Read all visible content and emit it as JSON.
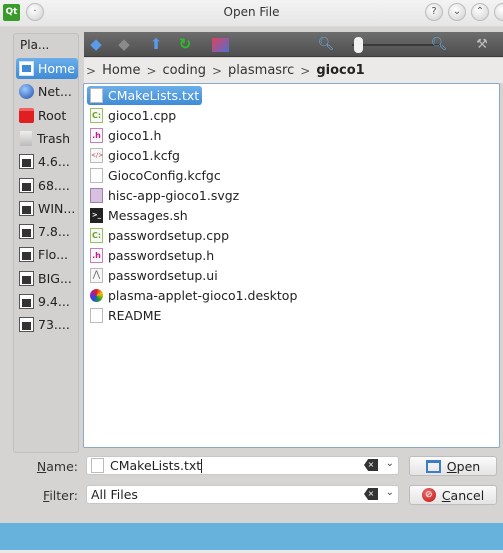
{
  "window": {
    "title": "Open File",
    "app_icon": "qt-icon",
    "controls": [
      "help-icon",
      "minimize-icon",
      "maximize-icon"
    ]
  },
  "places": {
    "header": "Pla...",
    "items": [
      {
        "label": "Home",
        "icon": "home-folder-icon",
        "active": true
      },
      {
        "label": "Net...",
        "icon": "network-globe-icon"
      },
      {
        "label": "Root",
        "icon": "root-folder-icon"
      },
      {
        "label": "Trash",
        "icon": "trash-icon"
      },
      {
        "label": "4.6...",
        "icon": "drive-icon"
      },
      {
        "label": "68....",
        "icon": "drive-icon"
      },
      {
        "label": "WIN...",
        "icon": "drive-icon"
      },
      {
        "label": "7.8...",
        "icon": "drive-icon"
      },
      {
        "label": "Flo...",
        "icon": "floppy-icon"
      },
      {
        "label": "BIG...",
        "icon": "drive-icon"
      },
      {
        "label": "9.4...",
        "icon": "drive-icon"
      },
      {
        "label": "73....",
        "icon": "drive-icon"
      }
    ]
  },
  "toolbar": {
    "buttons": [
      "back-arrow-icon",
      "forward-arrow-icon",
      "up-arrow-icon",
      "reload-icon",
      "new-folder-icon"
    ],
    "zoom_level": 0.1
  },
  "breadcrumb": {
    "items": [
      "Home",
      "coding",
      "plasmasrc",
      "gioco1"
    ]
  },
  "files": [
    {
      "name": "CMakeLists.txt",
      "type": "txt",
      "selected": true
    },
    {
      "name": "gioco1.cpp",
      "type": "cpp"
    },
    {
      "name": "gioco1.h",
      "type": "h"
    },
    {
      "name": "gioco1.kcfg",
      "type": "kcfg"
    },
    {
      "name": "GiocoConfig.kcfgc",
      "type": "txt"
    },
    {
      "name": "hisc-app-gioco1.svgz",
      "type": "svg"
    },
    {
      "name": "Messages.sh",
      "type": "sh"
    },
    {
      "name": "passwordsetup.cpp",
      "type": "cpp"
    },
    {
      "name": "passwordsetup.h",
      "type": "h"
    },
    {
      "name": "passwordsetup.ui",
      "type": "ui"
    },
    {
      "name": "plasma-applet-gioco1.desktop",
      "type": "desk"
    },
    {
      "name": "README",
      "type": "txt"
    }
  ],
  "form": {
    "name_label_pre": "",
    "name_label_u": "N",
    "name_label_post": "ame:",
    "name_value": "CMakeLists.txt",
    "filter_label_u": "F",
    "filter_label_post": "ilter:",
    "filter_value": "All Files",
    "open_u": "O",
    "open_post": "pen",
    "cancel_u": "C",
    "cancel_post": "ancel"
  },
  "colors": {
    "selection": "#3f8bd6",
    "statusbar": "#67b2dc"
  }
}
